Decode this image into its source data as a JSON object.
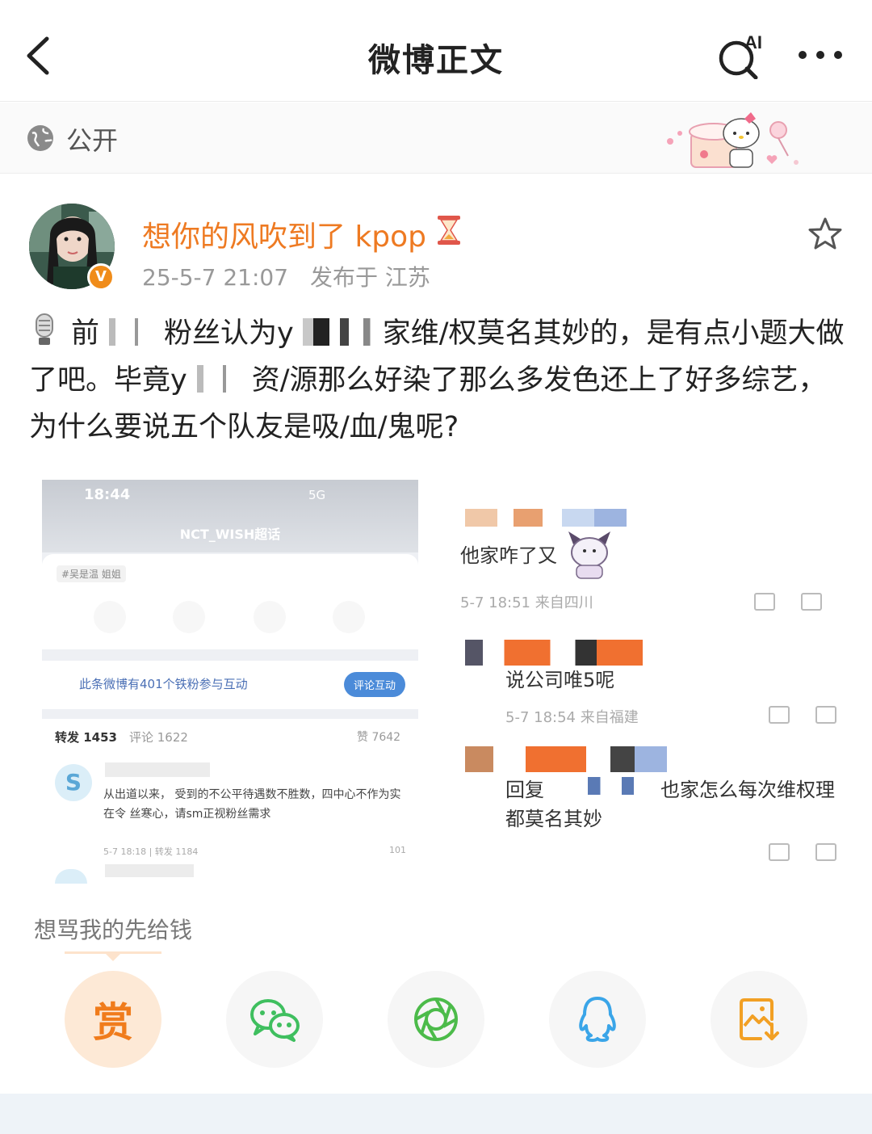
{
  "nav": {
    "title": "微博正文",
    "ai_label": "AI"
  },
  "visibility": {
    "label": "公开"
  },
  "author": {
    "name": "想你的风吹到了 kpop",
    "verified_mark": "V",
    "date": "25-5-7 21:07",
    "location": "发布于 江苏"
  },
  "post": {
    "text_1": "前",
    "text_1b": "粉丝认为",
    "text_2": "家维/权莫名其妙的，是有点小题大做了吧。毕竟",
    "text_3": "资/源那么好染了那么多发色还上了好多综艺，为什么要说五个队友是吸/血/鬼呢?",
    "text_y1": "y",
    "text_y2": "y"
  },
  "image_left": {
    "time": "18:44",
    "signal": "5G",
    "title": "NCT_WISH超话",
    "tag": "#吴是温 姐姐",
    "banner": "此条微博有401个铁粉参与互动",
    "banner_button": "评论互动",
    "tab_repost": "转发 1453",
    "tab_comment": "评论 1622",
    "likes": "赞 7642",
    "comment_text": "从出道以来，    受到的不公平待遇数不胜数，四中心不作为实在令    丝寒心，请sm正视粉丝需求",
    "comment_footer": "5-7 18:18 | 转发 1184",
    "comment_like_count": "101"
  },
  "image_right": {
    "comment1": "他家咋了又",
    "meta1": "5-7 18:51 来自四川",
    "comment2": "说公司唯5呢",
    "meta2": "5-7 18:54 来自福建",
    "comment3_prefix": "回复",
    "comment3_suffix": "也家怎么每次维权理",
    "comment3_line2": "都莫名其妙"
  },
  "reward": {
    "tagline": "想骂我的先给钱",
    "reward_label": "赏"
  },
  "colors": {
    "accent_orange": "#ee7a22",
    "wechat_green": "#3fbf5f",
    "moments_green": "#4cbb4a",
    "qq_blue": "#3aa5e8",
    "save_orange": "#f2a024"
  },
  "icons": [
    "back-icon",
    "ai-search-icon",
    "more-icon",
    "globe-icon",
    "star-icon",
    "microphone-icon",
    "hourglass-icon",
    "wechat-icon",
    "moments-icon",
    "qq-icon",
    "save-image-icon"
  ]
}
